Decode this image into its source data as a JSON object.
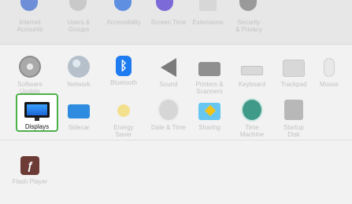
{
  "row1": {
    "items": [
      {
        "label": "Internet\nAccounts"
      },
      {
        "label": "Users &\nGroups"
      },
      {
        "label": "Accessibility"
      },
      {
        "label": "Screen Time"
      },
      {
        "label": "Extensions"
      },
      {
        "label": "Security\n& Privacy"
      }
    ]
  },
  "row2": {
    "items": [
      {
        "label": "Software\nUpdate"
      },
      {
        "label": "Network"
      },
      {
        "label": "Bluetooth"
      },
      {
        "label": "Sound"
      },
      {
        "label": "Printers &\nScanners"
      },
      {
        "label": "Keyboard"
      },
      {
        "label": "Trackpad"
      },
      {
        "label": "Mouse"
      }
    ]
  },
  "row3": {
    "items": [
      {
        "label": "Displays"
      },
      {
        "label": "Sidecar"
      },
      {
        "label": "Energy\nSaver"
      },
      {
        "label": "Date & Time"
      },
      {
        "label": "Sharing"
      },
      {
        "label": "Time\nMachine"
      },
      {
        "label": "Startup\nDisk"
      }
    ]
  },
  "row4": {
    "items": [
      {
        "label": "Flash Player"
      }
    ]
  },
  "icons": {
    "bluetooth_glyph": "ᛒ",
    "flash_glyph": "ƒ"
  },
  "colors": {
    "selection_border": "#4db14a",
    "bluetooth_blue": "#1e7bf0"
  }
}
